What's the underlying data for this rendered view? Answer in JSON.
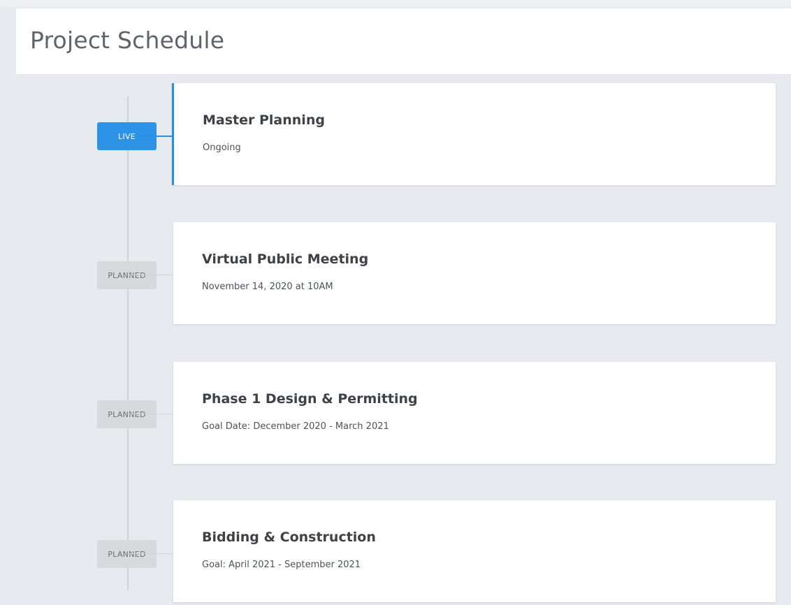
{
  "header": {
    "title": "Project Schedule"
  },
  "colors": {
    "background": "#e7eaee",
    "live_accent": "#2d93e6",
    "planned_badge": "#d7d9dc",
    "card": "#ffffff",
    "timeline": "#cfd3d8"
  },
  "timeline": {
    "items": [
      {
        "status": "LIVE",
        "title": "Master Planning",
        "subtitle": "Ongoing"
      },
      {
        "status": "PLANNED",
        "title": "Virtual Public Meeting",
        "subtitle": "November 14, 2020 at 10AM"
      },
      {
        "status": "PLANNED",
        "title": "Phase 1 Design & Permitting",
        "subtitle": "Goal Date:  December 2020 - March 2021"
      },
      {
        "status": "PLANNED",
        "title": "Bidding & Construction",
        "subtitle": "Goal:  April 2021 - September 2021"
      }
    ]
  }
}
